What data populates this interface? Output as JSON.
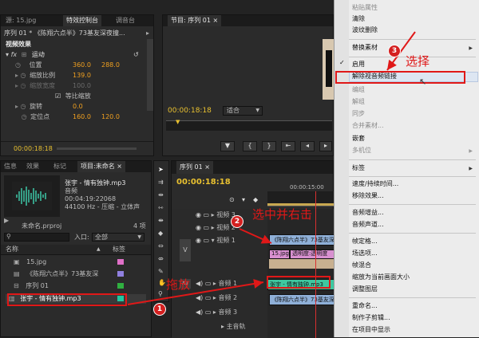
{
  "source_panel": {
    "tabs": [
      "源: 15.jpg",
      "特效控制台",
      "调音台"
    ],
    "sequence_label": "序列 01 * 《陈翔六点半》73基友深夜撞...",
    "section_title": "视频效果",
    "motion_label": "运动",
    "props": [
      {
        "name": "位置",
        "v1": "360.0",
        "v2": "288.0"
      },
      {
        "name": "缩放比例",
        "v1": "139.0",
        "v2": ""
      },
      {
        "name": "缩放宽度",
        "v1": "100.0",
        "v2": ""
      },
      {
        "name": "等比缩放",
        "v1": "",
        "v2": ""
      },
      {
        "name": "旋转",
        "v1": "0.0",
        "v2": ""
      },
      {
        "name": "定位点",
        "v1": "160.0",
        "v2": "120.0"
      }
    ],
    "timecode": "00:00:18:18"
  },
  "program_panel": {
    "title": "节目: 序列 01 ×",
    "timecode": "00:00:18:18",
    "fit_label": "适合"
  },
  "project_panel": {
    "tabs": [
      "信息",
      "效果",
      "标记",
      "项目:未命名 ×"
    ],
    "clip_name": "张宇 - 情有独钟.mp3",
    "clip_type": "音频",
    "clip_duration": "00:04:19:22068",
    "clip_format": "44100 Hz - 压缩 - 立体声",
    "project_file": "未命名.prproj",
    "item_count": "4 项",
    "entry_label": "入口:",
    "entry_value": "全部",
    "col_name": "名称",
    "col_label": "标签",
    "items": [
      {
        "name": "15.jpg",
        "color": "#e070c8"
      },
      {
        "name": "《陈翔六点半》73基友深",
        "color": "#9080e0"
      },
      {
        "name": "序列 01",
        "color": "#30b040"
      },
      {
        "name": "张宇 - 情有独钟.mp3",
        "color": "#20c8a0"
      }
    ]
  },
  "timeline_panel": {
    "tab": "序列 01 ×",
    "timecode": "00:00:18:18",
    "ruler_mark": "00:00:15:00",
    "tracks": [
      {
        "name": "视频 3"
      },
      {
        "name": "视频 2"
      },
      {
        "name": "视频 1"
      },
      {
        "name": "音频 1"
      },
      {
        "name": "音频 2"
      },
      {
        "name": "音频 3"
      },
      {
        "name": "主音轨"
      }
    ],
    "target_v": "V",
    "target_a": "A1",
    "clips": {
      "v2": "《陈翔六点半》73基友深",
      "v1_a": "15.jpg",
      "v1_b": "透明度:透明度",
      "a1": "张宇 - 情有独钟.mp3",
      "a2": "《陈翔六点半》73基友深"
    }
  },
  "context_menu": {
    "items": [
      {
        "label": "粘贴属性",
        "disabled": true
      },
      {
        "label": "清除"
      },
      {
        "label": "波纹删除"
      },
      {
        "label": "替换素材",
        "submenu": true
      },
      {
        "label": "启用",
        "checked": true
      },
      {
        "label": "解除视音频链接",
        "highlighted": true
      },
      {
        "label": "编组",
        "disabled": true
      },
      {
        "label": "解组",
        "disabled": true
      },
      {
        "label": "同步",
        "disabled": true
      },
      {
        "label": "合并素材...",
        "disabled": true
      },
      {
        "label": "嵌套"
      },
      {
        "label": "多机位",
        "disabled": true,
        "submenu": true
      },
      {
        "label": "标签",
        "submenu": true
      },
      {
        "label": "速度/持续时间..."
      },
      {
        "label": "移除效果..."
      },
      {
        "label": "音频增益..."
      },
      {
        "label": "音频声道..."
      },
      {
        "label": "帧定格..."
      },
      {
        "label": "场选项..."
      },
      {
        "label": "帧混合"
      },
      {
        "label": "缩放为当前画面大小"
      },
      {
        "label": "调整图层"
      },
      {
        "label": "重命名..."
      },
      {
        "label": "制作子剪辑..."
      },
      {
        "label": "在项目中显示"
      }
    ]
  },
  "annotations": {
    "step1": "拖放",
    "step2": "选中并右击",
    "step3": "选择",
    "n1": "1",
    "n2": "2",
    "n3": "3",
    "color": "#e01818"
  }
}
